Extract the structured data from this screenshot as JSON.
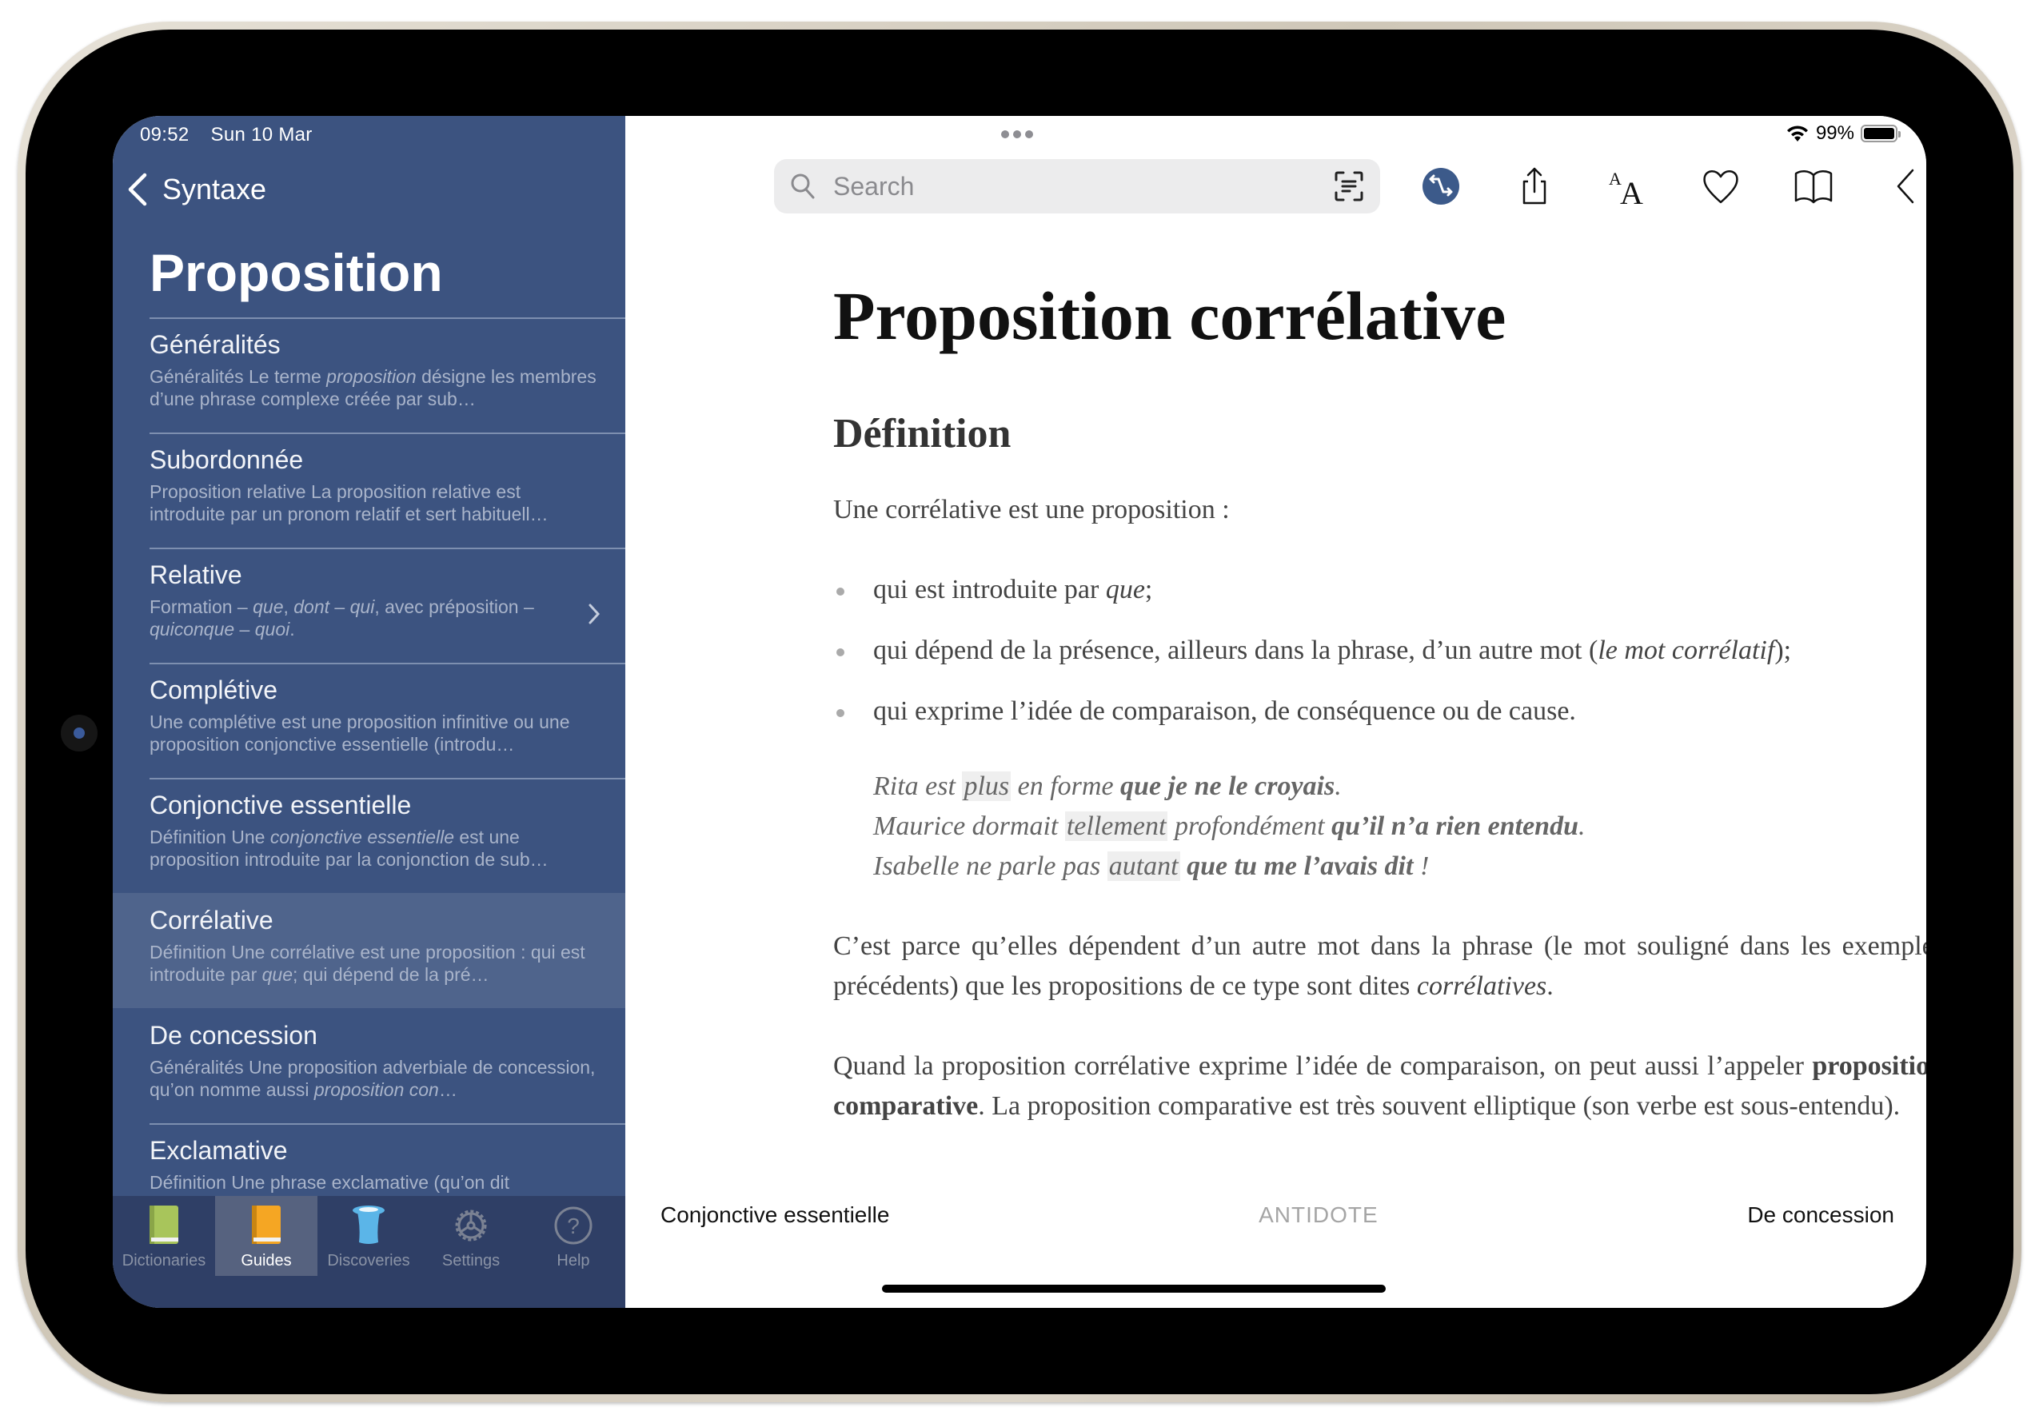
{
  "status_bar": {
    "time": "09:52",
    "date": "Sun 10 Mar",
    "battery": "99%",
    "battery_level": 0.99
  },
  "sidebar": {
    "back_label": "Syntaxe",
    "title": "Proposition",
    "items": [
      {
        "title": "Généralités",
        "snippet_html": "Généralités Le terme <i>proposition</i> désigne les membres d’une phrase complexe créée par sub…",
        "selected": false,
        "chevron": false
      },
      {
        "title": "Subordonnée",
        "snippet_html": "Proposition relative La proposition relative est introduite par un pronom relatif et sert habituell…",
        "selected": false,
        "chevron": false
      },
      {
        "title": "Relative",
        "snippet_html": "Formation – <i>que</i>, <i>dont</i> – <i>qui</i>, avec préposition – <i>quiconque</i> – <i>quoi</i>.",
        "selected": false,
        "chevron": true
      },
      {
        "title": "Complétive",
        "snippet_html": "Une complétive est une proposition infinitive ou une proposition conjonctive essentielle (introdu…",
        "selected": false,
        "chevron": false
      },
      {
        "title": "Conjonctive essentielle",
        "snippet_html": "Définition Une <i>conjonctive essentielle</i> est une proposition introduite par la conjonction de sub…",
        "selected": false,
        "chevron": false
      },
      {
        "title": "Corrélative",
        "snippet_html": "Définition Une corrélative est une proposition : qui est introduite par <i>que</i>; qui dépend de la pré…",
        "selected": true,
        "chevron": false
      },
      {
        "title": "De concession",
        "snippet_html": "Généralités Une proposition adverbiale de concession, qu’on nomme aussi <i>proposition con</i>…",
        "selected": false,
        "chevron": false
      },
      {
        "title": "Exclamative",
        "snippet_html": "Définition Une phrase exclamative (qu’on dit",
        "selected": false,
        "chevron": false
      }
    ]
  },
  "tabbar": {
    "tabs": [
      {
        "label": "Dictionaries",
        "icon": "green-book-icon",
        "active": false
      },
      {
        "label": "Guides",
        "icon": "orange-book-icon",
        "active": true
      },
      {
        "label": "Discoveries",
        "icon": "top-hat-icon",
        "active": false
      },
      {
        "label": "Settings",
        "icon": "gear-icon",
        "active": false
      },
      {
        "label": "Help",
        "icon": "question-circle-icon",
        "active": false
      }
    ]
  },
  "toolbar": {
    "search_placeholder": "Search",
    "search_value": "",
    "icons": [
      "search-icon",
      "text-scan-icon",
      "swap-language-icon",
      "share-icon",
      "text-size-icon",
      "favorite-heart-icon",
      "book-icon",
      "back-chevron-icon",
      "forward-chevron-icon"
    ]
  },
  "article": {
    "title": "Proposition corrélative",
    "section": "Définition",
    "intro": "Une corrélative est une proposition :",
    "bullets_html": [
      "qui est introduite par <i>que</i>;",
      "qui dépend de la présence, ailleurs dans la phrase, d’un autre mot (<i>le mot corrélatif</i>);",
      "qui exprime l’idée de comparaison, de conséquence ou de cause."
    ],
    "examples_html": [
      "Rita est <span class=\"hl\">plus</span> en forme <b>que je ne le croyais</b>.",
      "Maurice dormait <span class=\"hl\">tellement</span> profondément <b>qu’il n’a rien entendu</b>.",
      "Isabelle ne parle pas <span class=\"hl\">autant</span> <b>que tu me l’avais dit</b> !"
    ],
    "paragraphs_html": [
      "C’est parce qu’elles dépendent d’un autre mot dans la phrase (le mot souligné dans les exemples précédents) que les propositions de ce type sont dites <i>corrélatives</i>.",
      "Quand la proposition corrélative exprime l’idée de comparaison, on peut aussi l’appeler <b>proposition comparative</b>. La proposition comparative est très souvent elliptique (son verbe est sous-entendu)."
    ]
  },
  "bottom_nav": {
    "previous": "Conjonctive essentielle",
    "brand": "ANTIDOTE",
    "next": "De concession"
  },
  "colors": {
    "sidebar_bg": "#3c5380",
    "sidebar_selected": "#4f648c",
    "tabbar_bg": "#2f3f66",
    "accent": "#3c5a8a"
  }
}
